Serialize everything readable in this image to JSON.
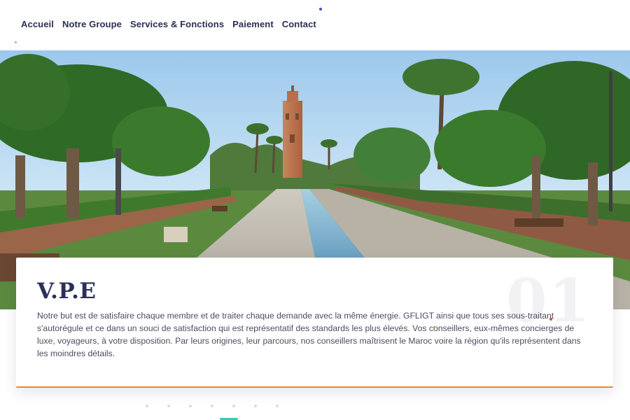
{
  "nav": {
    "items": [
      {
        "label": "Accueil"
      },
      {
        "label": "Notre Groupe"
      },
      {
        "label": "Services & Fonctions"
      },
      {
        "label": "Paiement"
      },
      {
        "label": "Contact"
      }
    ]
  },
  "hero": {
    "image_subject": "Marrakech park with palm trees, fountains and minaret"
  },
  "card": {
    "number": "01",
    "title": "V.P.E",
    "text": "Notre but est de satisfaire chaque membre et de traiter chaque demande avec la même énergie. GFLIGT ainsi que tous ses sous-traitant s'autorégule et ce dans un souci de satisfaction qui est représentatif des standards les plus élevés. Vos conseillers, eux-mêmes concierges de luxe, voyageurs, à votre disposition. Par leurs origines, leur parcours, nos conseillers maîtrisent le Maroc voire la région qu'ils représentent dans les moindres détails."
  },
  "colors": {
    "nav_text": "#2a2f55",
    "card_accent": "#e58a2e",
    "teal": "#3ec7b6"
  },
  "pager": {
    "count": 7
  }
}
